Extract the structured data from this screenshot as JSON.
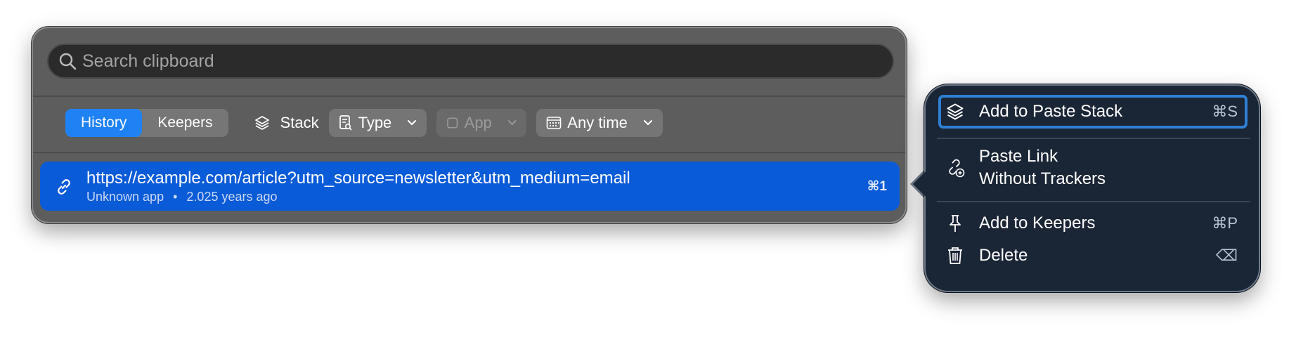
{
  "search": {
    "placeholder": "Search clipboard"
  },
  "filters": {
    "tabs": [
      {
        "label": "History",
        "active": true
      },
      {
        "label": "Keepers",
        "active": false
      }
    ],
    "stack_label": "Stack",
    "type_label": "Type",
    "app_label": "App",
    "time_label": "Any time"
  },
  "items": [
    {
      "url": "https://example.com/article?utm_source=newsletter&utm_medium=email",
      "source": "Unknown app",
      "separator": "•",
      "age": "2.025 years ago",
      "shortcut": "⌘1"
    }
  ],
  "context_menu": {
    "items": [
      {
        "label": "Add to Paste Stack",
        "shortcut": "⌘S",
        "icon": "layers-icon"
      },
      {
        "label_line1": "Paste Link",
        "label_line2": "Without Trackers",
        "icon": "link-clean-icon"
      },
      {
        "label": "Add to Keepers",
        "shortcut": "⌘P",
        "icon": "pin-icon"
      },
      {
        "label": "Delete",
        "shortcut": "⌫",
        "icon": "trash-icon"
      }
    ]
  },
  "colors": {
    "accent": "#1e82f5",
    "selection": "#0a5bd8",
    "menu_bg": "#1a2535"
  }
}
